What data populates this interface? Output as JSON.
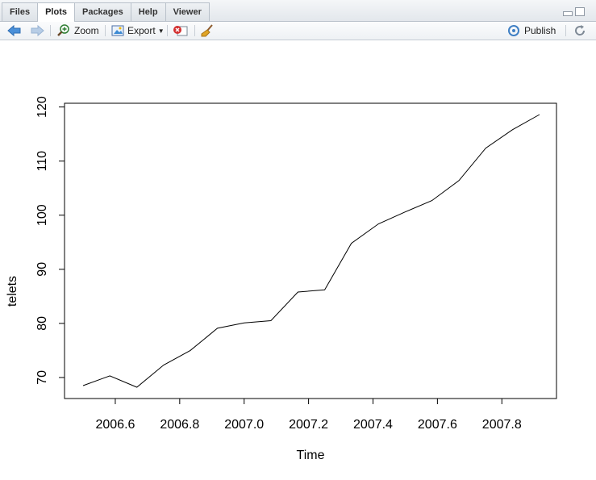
{
  "tabs": [
    {
      "label": "Files"
    },
    {
      "label": "Plots"
    },
    {
      "label": "Packages"
    },
    {
      "label": "Help"
    },
    {
      "label": "Viewer"
    }
  ],
  "active_tab": "Plots",
  "toolbar": {
    "zoom_label": "Zoom",
    "export_label": "Export",
    "publish_label": "Publish"
  },
  "chart_data": {
    "type": "line",
    "xlabel": "Time",
    "ylabel": "telets",
    "xlim": [
      2006.5,
      2007.917
    ],
    "ylim": [
      68.2,
      118.6
    ],
    "x_ticks": [
      "2006.6",
      "2006.8",
      "2007.0",
      "2007.2",
      "2007.4",
      "2007.6",
      "2007.8"
    ],
    "x_tick_values": [
      2006.6,
      2006.8,
      2007.0,
      2007.2,
      2007.4,
      2007.6,
      2007.8
    ],
    "y_ticks": [
      "70",
      "80",
      "90",
      "100",
      "110",
      "120"
    ],
    "y_tick_values": [
      70,
      80,
      90,
      100,
      110,
      120
    ],
    "series": [
      {
        "x": [
          2006.5,
          2006.583,
          2006.667,
          2006.75,
          2006.833,
          2006.917,
          2007.0,
          2007.083,
          2007.167,
          2007.25,
          2007.333,
          2007.417,
          2007.5,
          2007.583,
          2007.667,
          2007.75,
          2007.833,
          2007.917
        ],
        "values": [
          68.5,
          70.3,
          68.2,
          72.3,
          75.0,
          79.1,
          80.1,
          80.5,
          85.8,
          86.2,
          94.8,
          98.4,
          100.6,
          102.7,
          106.4,
          112.4,
          115.8,
          118.6
        ]
      }
    ]
  }
}
